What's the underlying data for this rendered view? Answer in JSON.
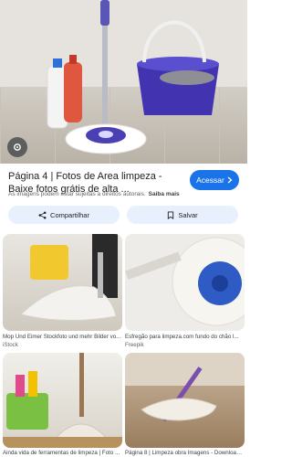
{
  "main_result": {
    "title": "Página 4 | Fotos de Area limpeza - Baixe fotos grátis de alta ...",
    "visit_label": "Acessar",
    "notice": "As imagens podem estar sujeitas a direitos autorais.",
    "learn_more": "Saiba mais",
    "share_label": "Compartilhar",
    "save_label": "Salvar"
  },
  "related": [
    {
      "title": "Mop Und Eimer Stockfoto und mehr Bilder vo...",
      "source": "iStock"
    },
    {
      "title": "Esfregão para limpeza.com fundo do chão l...",
      "source": "Freepik"
    },
    {
      "title": "Ainda vida de ferramentas de limpeza | Foto ...",
      "source": ""
    },
    {
      "title": "Página 8 | Limpeza obra Imagens - Download ...",
      "source": ""
    }
  ],
  "colors": {
    "accent": "#1a73e8",
    "chip_bg": "#e8f0fe"
  },
  "icons": [
    "lens-icon",
    "chevron-right-icon",
    "share-icon",
    "bookmark-icon"
  ]
}
